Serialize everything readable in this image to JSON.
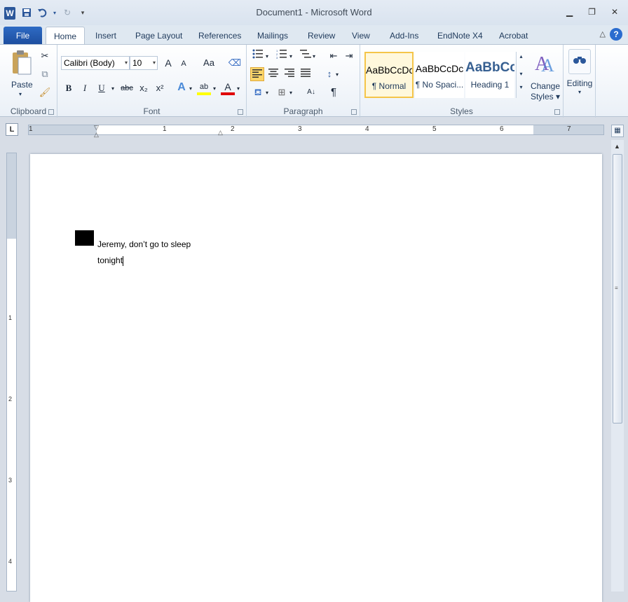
{
  "window": {
    "title": "Document1  -  Microsoft Word",
    "app_logo": "W",
    "controls": [
      "minimize-icon",
      "restore-icon",
      "close-icon"
    ]
  },
  "quick_access": {
    "save": "save-icon",
    "undo": "undo-icon",
    "redo": "redo-icon",
    "customize": "customize-qat-icon"
  },
  "tabs": {
    "file": "File",
    "items": [
      "Home",
      "Insert",
      "Page Layout",
      "References",
      "Mailings",
      "Review",
      "View",
      "Add-Ins",
      "EndNote X4",
      "Acrobat"
    ],
    "active": "Home"
  },
  "ribbon": {
    "clipboard": {
      "label": "Clipboard",
      "paste": "Paste",
      "paste_arrow": "▾"
    },
    "font": {
      "label": "Font",
      "font_name": "Calibri (Body)",
      "font_size": "10",
      "grow": "A",
      "shrink": "A",
      "change_case": "Aa",
      "bold": "B",
      "italic": "I",
      "underline": "U",
      "strike": "abc",
      "subscript": "x₂",
      "superscript": "x²",
      "text_effects": "A",
      "highlight": "ab",
      "font_color": "A"
    },
    "paragraph": {
      "label": "Paragraph",
      "sort": "A↓",
      "show_hide": "¶"
    },
    "styles": {
      "label": "Styles",
      "items": [
        {
          "sample": "AaBbCcDc",
          "name": "¶ Normal"
        },
        {
          "sample": "AaBbCcDc",
          "name": "¶ No Spaci..."
        },
        {
          "sample": "AaBbCc",
          "name": "Heading 1"
        }
      ],
      "change_styles_line1": "Change",
      "change_styles_line2": "Styles ▾"
    },
    "editing": {
      "label": "Editing",
      "arrow": "▾"
    }
  },
  "ruler": {
    "tab_selector": "L",
    "h_numbers": [
      "1",
      "1",
      "2",
      "3",
      "4",
      "5",
      "6",
      "7"
    ],
    "v_numbers": [
      "1",
      "2",
      "3",
      "4"
    ]
  },
  "document": {
    "line1": "Jeremy, don’t go to sleep",
    "line2": "tonight"
  },
  "colors": {
    "file_tab": "#2b579a",
    "accent": "#2b579a",
    "selected_style_border": "#f5c549",
    "font_color_bar": "#e00000",
    "highlight_bar": "#ffff00"
  }
}
